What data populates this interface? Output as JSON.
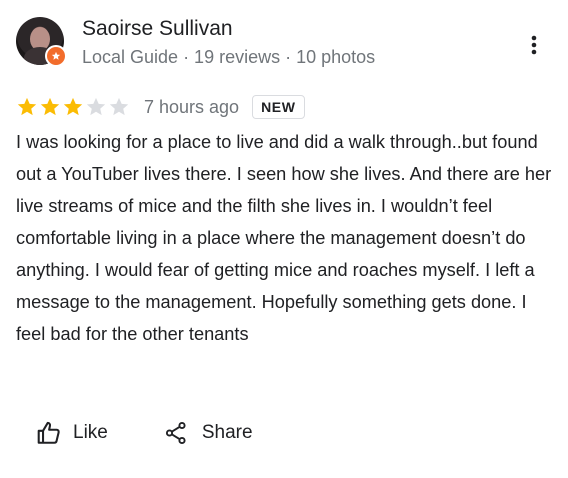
{
  "reviewer": {
    "name": "Saoirse Sullivan",
    "meta": "Local Guide · 19 reviews · 10 photos"
  },
  "review": {
    "rating": 3,
    "max_rating": 5,
    "time": "7 hours ago",
    "badge": "NEW",
    "text": "I was looking for a place to live and did a walk through..but found out a YouTuber lives there. I seen how she lives. And there are her live streams of mice and the filth she lives in. I wouldn’t feel comfortable living in a place where the management doesn’t do anything. I would fear of getting mice and roaches myself. I left a message to the management. Hopefully something gets done. I feel bad for the other tenants"
  },
  "actions": {
    "like_label": "Like",
    "share_label": "Share"
  },
  "icons": {
    "more": "more-vert-icon",
    "like": "thumb-up-icon",
    "share": "share-icon",
    "badge": "local-guide-star-icon"
  },
  "colors": {
    "star_filled": "#fbbc04",
    "star_empty": "#dadce0",
    "badge_orange": "#f26c2b",
    "secondary_text": "#70757a"
  }
}
